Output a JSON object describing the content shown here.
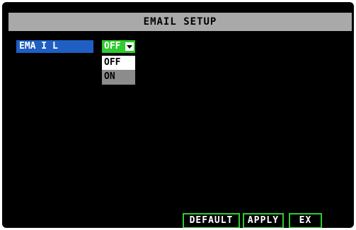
{
  "window": {
    "title": "EMAIL SETUP"
  },
  "form": {
    "email_label": "EMA I L",
    "email_value": "OFF",
    "email_options": [
      "OFF",
      "ON"
    ]
  },
  "buttons": {
    "default": "DEFAULT",
    "apply": "APPLY",
    "exit": "EX IT"
  },
  "colors": {
    "title_bar": "#a9a9a9",
    "label_highlight": "#1f5fc4",
    "select_active": "#2ecc2e",
    "button_border": "#2ecc2e",
    "background": "#000000"
  },
  "icons": {
    "dropdown_arrow": "chevron-down-icon"
  }
}
